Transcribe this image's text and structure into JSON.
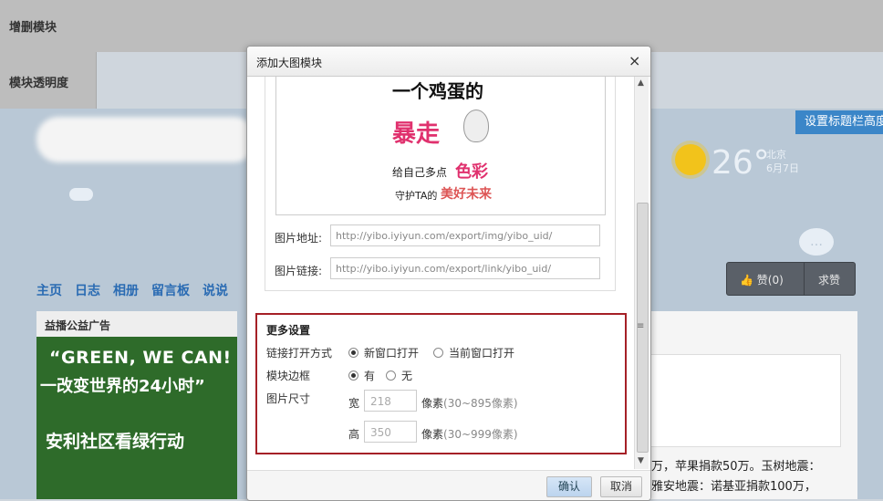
{
  "background": {
    "top_tab": "增删模块",
    "transparency_tab": "模块透明度",
    "set_title_button": "设置标题栏高度",
    "weather": {
      "temperature": "26°",
      "city": "北京",
      "date": "6月7日"
    },
    "nav": [
      "主页",
      "日志",
      "相册",
      "留言板",
      "说说"
    ],
    "like": {
      "label": "赞(0)",
      "request": "求赞"
    },
    "ad_panel": {
      "title": "益播公益广告",
      "line1": "“GREEN, WE CAN!",
      "line2": "一改变世界的24小时”",
      "line3": "安利社区看绿行动"
    },
    "news_line1": "万，苹果捐款50万。玉树地震：",
    "news_line2": "雅安地震：诺基亚捐款100万，"
  },
  "dialog": {
    "title": "添加大图模块",
    "close": "×",
    "preview": {
      "line1": "一个鸡蛋的",
      "line2": "暴走",
      "line3": "给自己多点",
      "line3b": "色彩",
      "line4": "守护TA的",
      "line4b": "美好未来"
    },
    "image_url_label": "图片地址:",
    "image_url_value": "http://yibo.iyiyun.com/export/img/yibo_uid/",
    "image_link_label": "图片链接:",
    "image_link_value": "http://yibo.iyiyun.com/export/link/yibo_uid/",
    "more_settings": {
      "title": "更多设置",
      "open_mode_label": "链接打开方式",
      "open_new": "新窗口打开",
      "open_current": "当前窗口打开",
      "open_mode_selected": "新窗口打开",
      "border_label": "模块边框",
      "border_yes": "有",
      "border_no": "无",
      "border_selected": "有",
      "size_label": "图片尺寸",
      "width_label": "宽",
      "width_value": "218",
      "width_unit": "像素",
      "width_range": "(30~895像素)",
      "height_label": "高",
      "height_value": "350",
      "height_unit": "像素",
      "height_range": "(30~999像素)"
    },
    "ok_button": "确认",
    "cancel_button": "取消"
  }
}
